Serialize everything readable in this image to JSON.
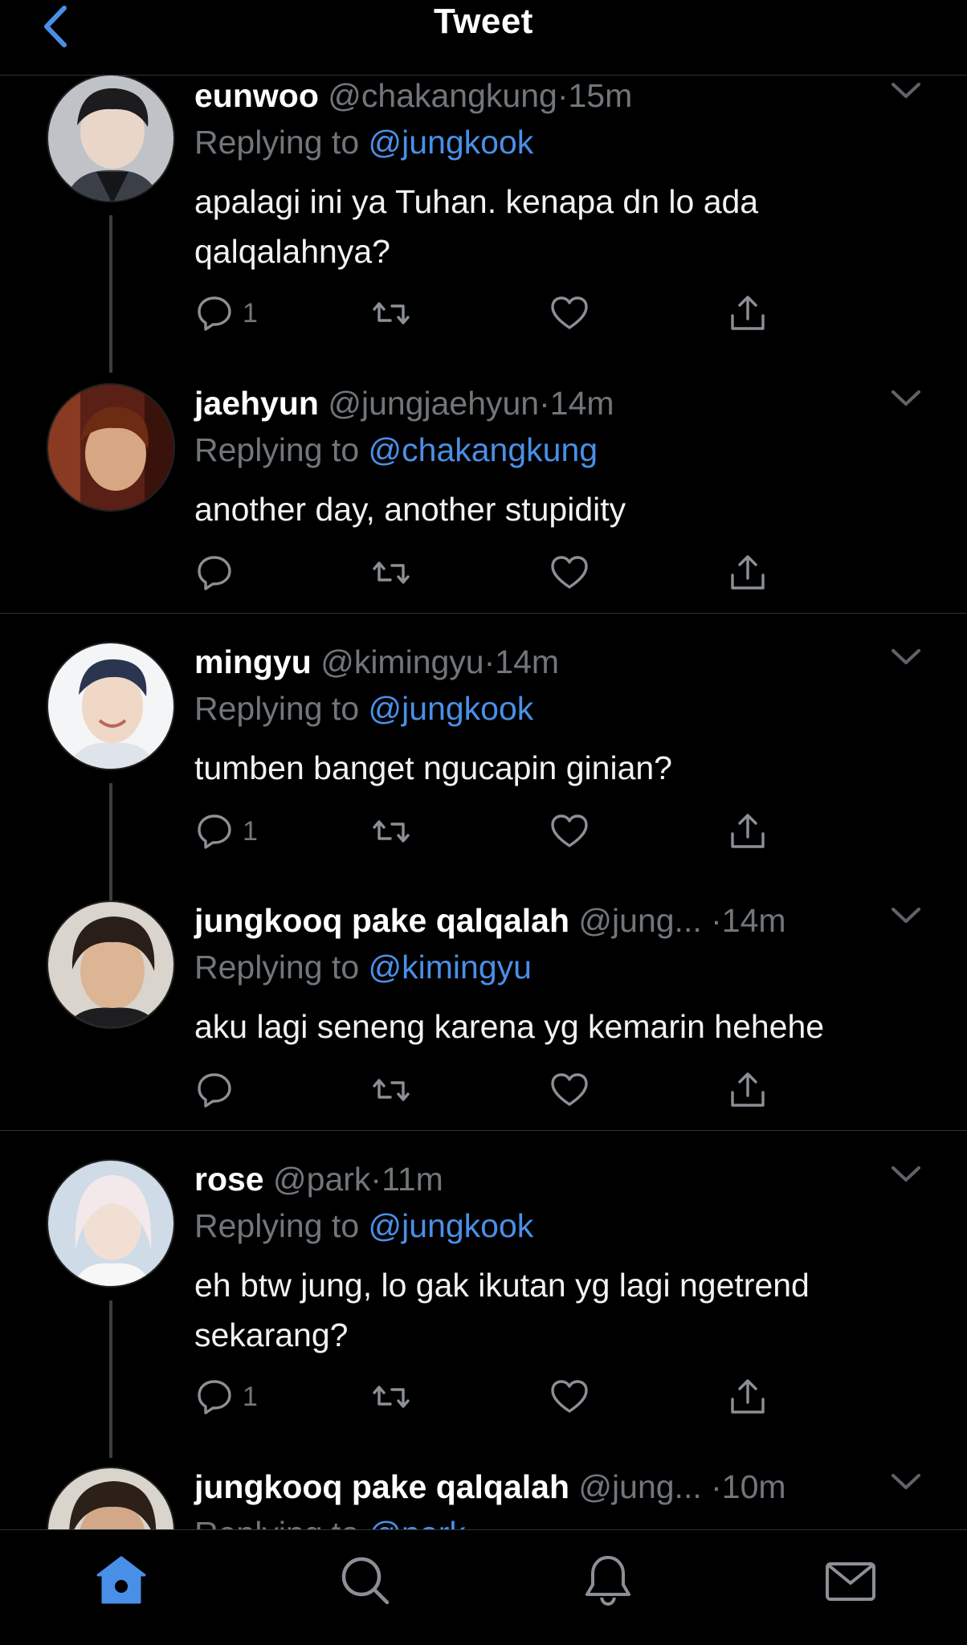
{
  "header": {
    "title": "Tweet"
  },
  "colors": {
    "accent": "#4a8fe7",
    "muted": "#71767b",
    "background": "#000000"
  },
  "tweets": [
    {
      "name": "eunwoo",
      "handle": "@chakangkung",
      "time": "15m",
      "reply_prefix": "Replying to",
      "reply_to": "@jungkook",
      "text": "apalagi ini ya Tuhan. kenapa dn lo ada qalqalahnya?",
      "reply_count": "1"
    },
    {
      "name": "jaehyun",
      "handle": "@jungjaehyun",
      "time": "14m",
      "reply_prefix": "Replying to",
      "reply_to": "@chakangkung",
      "text": "another day, another stupidity",
      "reply_count": ""
    },
    {
      "name": "mingyu",
      "handle": "@kimingyu",
      "time": "14m",
      "reply_prefix": "Replying to",
      "reply_to": "@jungkook",
      "text": "tumben banget ngucapin ginian?",
      "reply_count": "1"
    },
    {
      "name": "jungkooq pake qalqalah",
      "handle": "@jung...",
      "time": "14m",
      "reply_prefix": "Replying to",
      "reply_to": "@kimingyu",
      "text": "aku lagi seneng karena yg kemarin hehehe",
      "reply_count": ""
    },
    {
      "name": "rose",
      "handle": "@park",
      "time": "11m",
      "reply_prefix": "Replying to",
      "reply_to": "@jungkook",
      "text": "eh btw jung, lo gak ikutan yg lagi ngetrend sekarang?",
      "reply_count": "1"
    },
    {
      "name": "jungkooq pake qalqalah",
      "handle": "@jung...",
      "time": "10m",
      "reply_prefix": "Replying to",
      "reply_to": "@park",
      "text": "",
      "reply_count": ""
    }
  ],
  "tabbar": {
    "items": [
      "home-icon",
      "search-icon",
      "notifications-icon",
      "messages-icon"
    ]
  }
}
